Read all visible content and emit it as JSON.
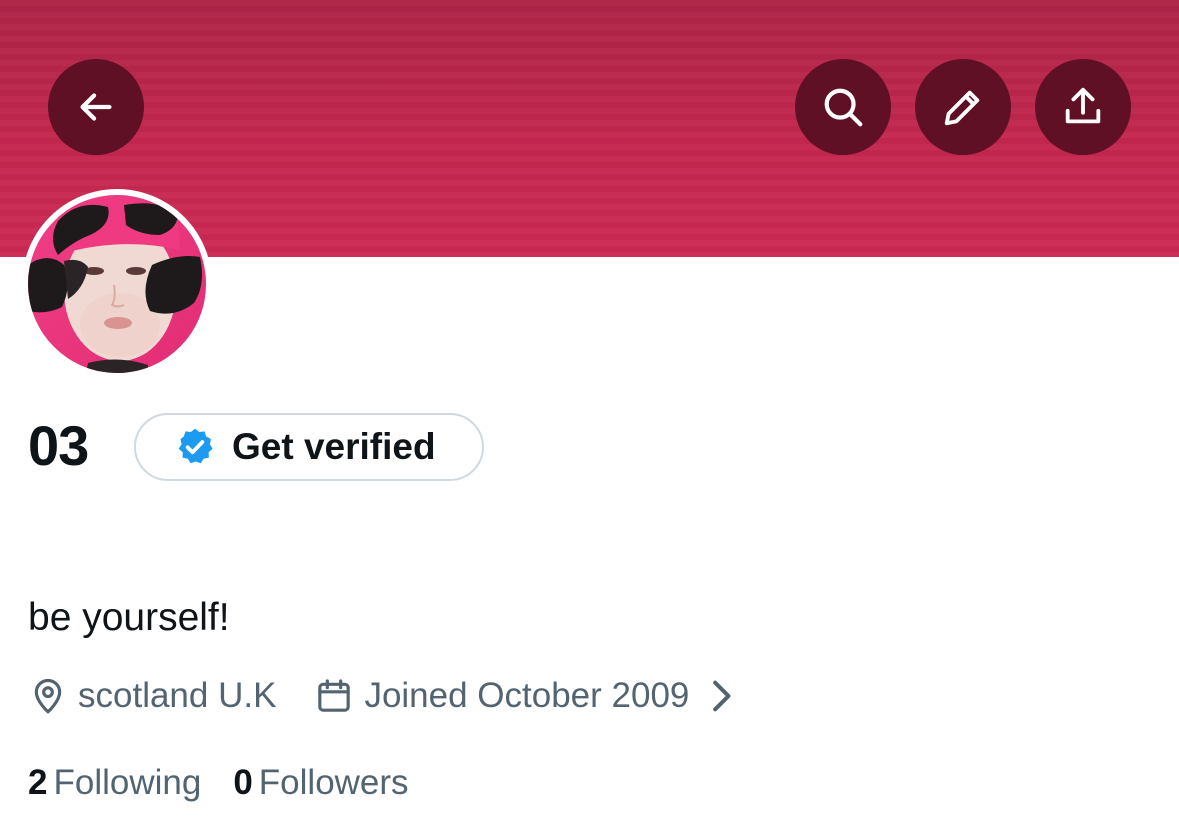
{
  "header": {
    "banner_color": "#c4274f",
    "button_color": "#5f1024",
    "icons": [
      "back-arrow-icon",
      "search-icon",
      "pencil-icon",
      "share-icon"
    ]
  },
  "profile": {
    "display_name": "03",
    "verify_button_label": "Get verified",
    "verify_badge_color": "#1d9bf0",
    "bio": "be yourself!",
    "location": "scotland U.K",
    "joined": "Joined October 2009",
    "following_count": "2",
    "following_label": "Following",
    "followers_count": "0",
    "followers_label": "Followers"
  }
}
